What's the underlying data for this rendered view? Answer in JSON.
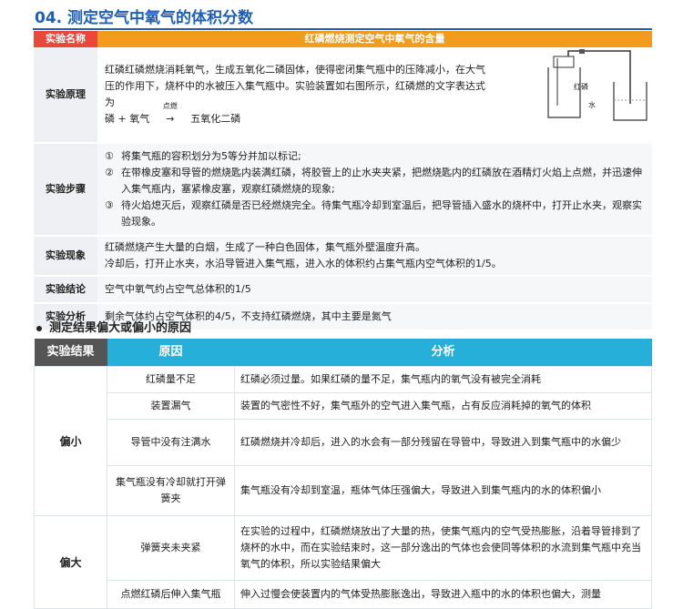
{
  "section_title": "04. 测定空气中氧气的体积分数",
  "table1": {
    "header_label": "实验名称",
    "header_value": "红磷燃烧测定空气中氧气的含量",
    "principle_label": "实验原理",
    "principle_text": "红磷红磷燃烧消耗氧气，生成五氧化二磷固体，使得密闭集气瓶中的压降减小，在大气压的作用下，烧杯中的水被压入集气瓶中。实验装置如右图所示，红磷燃的文字表达式为",
    "equation_left": "磷 + 氧气",
    "equation_condition": "点燃",
    "equation_right": "五氧化二磷",
    "apparatus_label_phosphorus": "红磷",
    "apparatus_label_water": "水",
    "steps_label": "实验步骤",
    "steps": [
      {
        "num": "①",
        "text": "将集气瓶的容积划分为5等分并加以标记;"
      },
      {
        "num": "②",
        "text": "在带橡皮塞和导管的燃烧匙内装满红磷，将胶管上的止水夹夹紧，把燃烧匙内的红磷放在酒精灯火焰上点燃，并迅速伸入集气瓶内，塞紧橡皮塞，观察红磷燃烧的现象;"
      },
      {
        "num": "③",
        "text": "待火焰熄灭后，观察红磷是否已经燃烧完全。待集气瓶冷却到室温后，把导管插入盛水的烧杯中，打开止水夹，观察实验现象。"
      }
    ],
    "phenomenon_label": "实验现象",
    "phenomenon_1": "红磷燃烧产生大量的白烟，生成了一种白色固体，集气瓶外壁温度升高。",
    "phenomenon_2": "冷却后，打开止水夹，水沿导管进入集气瓶，进入水的体积约占集气瓶内空气体积的1/5。",
    "conclusion_label": "实验结论",
    "conclusion_text": "空气中氧气约占空气总体积的1/5",
    "analysis_label": "实验分析",
    "analysis_text": "剩余气体约占空气体积的4/5，不支持红磷燃烧，其中主要是氮气"
  },
  "subsection_title": "测定结果偏大或偏小的原因",
  "table2": {
    "col_result": "实验结果",
    "col_reason": "原因",
    "col_analysis": "分析",
    "small_label": "偏小",
    "large_label": "偏大",
    "small_rows": [
      {
        "reason": "红磷量不足",
        "analysis": "红磷必须过量。如果红磷的量不足，集气瓶内的氧气没有被完全消耗"
      },
      {
        "reason": "装置漏气",
        "analysis": "装置的气密性不好，集气瓶外的空气进入集气瓶，占有反应消耗掉的氧气的体积"
      },
      {
        "reason": "导管中没有注满水",
        "analysis": "红磷燃烧并冷却后，进入的水会有一部分残留在导管中，导致进入到集气瓶中的水偏少"
      },
      {
        "reason": "集气瓶没有冷却就打开弹簧夹",
        "analysis": "集气瓶没有冷却到室温，瓶体气体压强偏大，导致进入到集气瓶内的水的体积偏小"
      }
    ],
    "large_rows": [
      {
        "reason": "弹簧夹未夹紧",
        "analysis": "在实验的过程中，红磷燃烧放出了大量的热，使集气瓶内的空气受热膨胀，沿着导管排到了烧杯的水中，而在实验结束时，这一部分逸出的气体也会使同等体积的水流到集气瓶中充当氧气的体积，所以实验结果偏大"
      },
      {
        "reason": "点燃红磷后伸入集气瓶",
        "analysis": "伸入过慢会使装置内的气体受热膨胀逸出，导致进入瓶中的水的体积也偏大，测量"
      }
    ]
  }
}
